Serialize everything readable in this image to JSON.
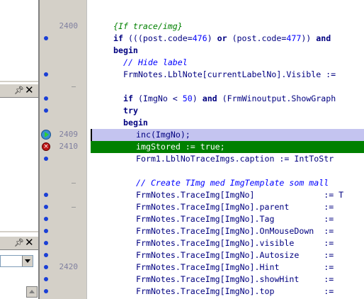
{
  "panels": {
    "upper_caption": {
      "pin_icon": "pin-icon",
      "close_icon": "close-icon"
    },
    "lower_caption": {
      "pin_icon": "pin-icon",
      "close_icon": "close-icon"
    }
  },
  "gutter": {
    "line_numbers": {
      "l2400": "2400",
      "l2409": "2409",
      "l2410": "2410",
      "l2420": "2420"
    }
  },
  "code": {
    "l1": "{If trace/img}",
    "l2": {
      "kw_if": "if",
      "a": " (((post.code=",
      "n476": "476",
      "b": ") ",
      "kw_or": "or",
      "c": " (post.code=",
      "n477": "477",
      "d": ")) ",
      "kw_and": "and"
    },
    "l3": "begin",
    "l4": "// Hide label",
    "l5": "FrmNotes.LblNote[currentLabelNo].Visible :=",
    "l7": {
      "kw_if": "if",
      "a": " (ImgNo < ",
      "n50": "50",
      "b": ") ",
      "kw_and": "and",
      "c": " (FrmWinoutput.ShowGraph"
    },
    "l8": "try",
    "l9": "begin",
    "l10": "inc(ImgNo);",
    "l11": "imgStored := true;",
    "l12": "Form1.LblNoTraceImgs.caption := IntToStr",
    "l14": "// Create TImg med ImgTemplate som mall",
    "l15": "FrmNotes.TraceImg[ImgNo]              := T",
    "l16": "FrmNotes.TraceImg[ImgNo].parent       :=",
    "l17": "FrmNotes.TraceImg[ImgNo].Tag          :=",
    "l18": "FrmNotes.TraceImg[ImgNo].OnMouseDown  :=",
    "l19": "FrmNotes.TraceImg[ImgNo].visible      :=",
    "l20": "FrmNotes.TraceImg[ImgNo].Autosize     :=",
    "l21": "FrmNotes.TraceImg[ImgNo].Hint         :=",
    "l22": "FrmNotes.TraceImg[ImgNo].showHint     :=",
    "l23": "FrmNotes.TraceImg[ImgNo].top          :="
  }
}
